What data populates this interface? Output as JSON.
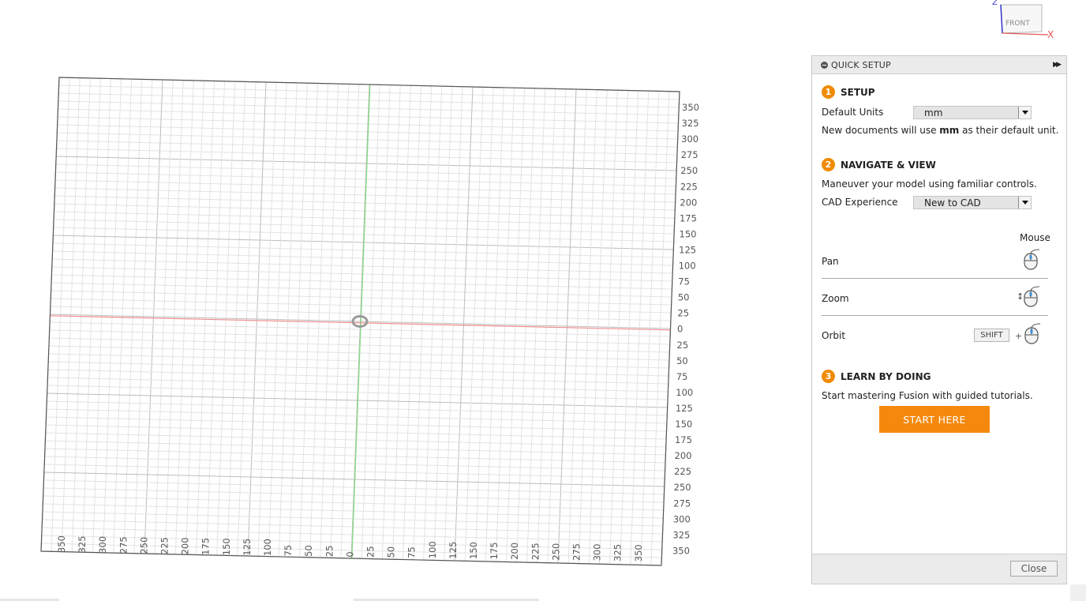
{
  "viewcube": {
    "face": "FRONT",
    "axis_x": "X",
    "axis_z": "Z"
  },
  "grid": {
    "right_labels": [
      "350",
      "325",
      "300",
      "275",
      "250",
      "225",
      "200",
      "175",
      "150",
      "125",
      "100",
      "75",
      "50",
      "25",
      "0",
      "25",
      "50",
      "75",
      "100",
      "125",
      "150",
      "175",
      "200",
      "225",
      "250",
      "275",
      "300",
      "325",
      "350"
    ],
    "bottom_labels": [
      "350",
      "325",
      "300",
      "275",
      "250",
      "225",
      "200",
      "175",
      "150",
      "125",
      "100",
      "75",
      "50",
      "25",
      "0",
      "25",
      "50",
      "75",
      "100",
      "125",
      "150",
      "175",
      "200",
      "225",
      "250",
      "275",
      "300",
      "325",
      "350"
    ],
    "colors": {
      "x_axis": "#f08e8e",
      "y_axis": "#7fdc7f",
      "minor": "#e3e3e3",
      "major": "#bdbdbd",
      "border": "#555555"
    }
  },
  "quick_setup": {
    "title": "QUICK SETUP",
    "setup": {
      "number": "1",
      "title": "SETUP",
      "units_label": "Default Units",
      "units_value": "mm",
      "note_prefix": "New documents will use ",
      "note_bold": "mm",
      "note_suffix": " as their default unit."
    },
    "navigate": {
      "number": "2",
      "title": "NAVIGATE & VIEW",
      "description": "Maneuver your model using familiar controls.",
      "cad_label": "CAD Experience",
      "cad_value": "New to CAD",
      "mouse_header": "Mouse",
      "pan": "Pan",
      "zoom": "Zoom",
      "orbit": "Orbit",
      "shift_key": "SHIFT",
      "plus": "+"
    },
    "learn": {
      "number": "3",
      "title": "LEARN BY DOING",
      "description": "Start mastering Fusion with guided tutorials.",
      "start_button": "START HERE"
    },
    "close_button": "Close",
    "accent_color": "#f08a00"
  }
}
